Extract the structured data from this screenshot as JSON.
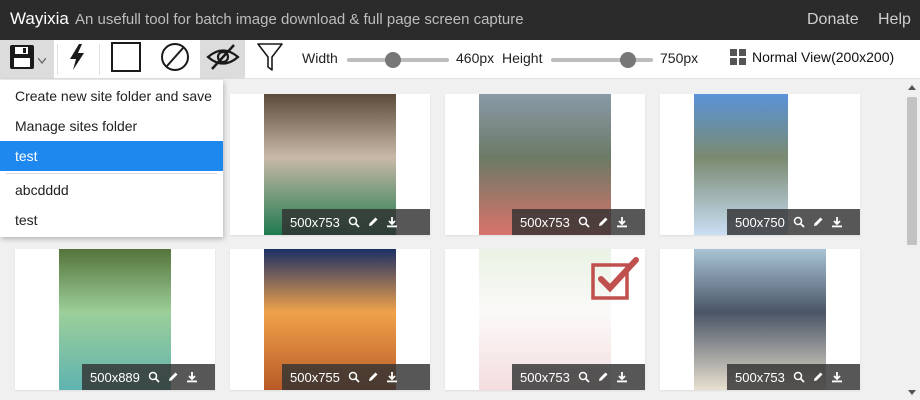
{
  "app": {
    "name": "Wayixia",
    "description": "An usefull tool for batch image download & full page screen capture",
    "donate": "Donate",
    "help": "Help"
  },
  "toolbar": {
    "width_label": "Width",
    "width_value": "460px",
    "width_fraction": 0.45,
    "height_label": "Height",
    "height_value": "750px",
    "height_fraction": 0.75,
    "view_mode": "Normal View(200x200)"
  },
  "menu": {
    "items": [
      "Create new site folder and save",
      "Manage sites folder",
      "test"
    ],
    "sites": [
      "abcdddd",
      "test"
    ],
    "selected_index": 2
  },
  "images": [
    {
      "size": "500x753",
      "colors": [
        "#5c4a3a",
        "#1f7a4f",
        "#c9b9a8"
      ]
    },
    {
      "size": "500x753",
      "colors": [
        "#8a9aa8",
        "#d9736a",
        "#6b7a66"
      ]
    },
    {
      "size": "500x750",
      "colors": [
        "#5a93d8",
        "#c9def5",
        "#7a8a70"
      ]
    },
    {
      "size": "500x889",
      "colors": [
        "#55733a",
        "#5fb3b0",
        "#9ccf9a"
      ]
    },
    {
      "size": "500x755",
      "colors": [
        "#1c2f66",
        "#b85a28",
        "#f0a24a"
      ]
    },
    {
      "size": "500x753",
      "colors": [
        "#cfe3c4",
        "#e6b3b8",
        "#f6f2ef"
      ],
      "selected": true
    },
    {
      "size": "500x753",
      "colors": [
        "#a9c4d6",
        "#e7e0cf",
        "#4a5566"
      ]
    }
  ],
  "icons": {
    "save": "save-icon",
    "capture": "lightning-icon",
    "select_all": "square-icon",
    "deselect": "ban-icon",
    "hide": "eye-slash-icon",
    "filter": "filter-icon",
    "zoom": "magnifier-icon",
    "edit": "pencil-icon",
    "download": "download-icon",
    "view": "grid-icon"
  },
  "colors": {
    "accent": "#1e88ee",
    "titlebar": "#2b2b2b",
    "check": "#c0504d"
  }
}
